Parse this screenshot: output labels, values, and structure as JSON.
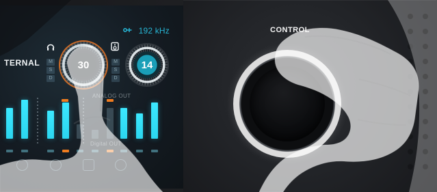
{
  "screen": {
    "freq_text": "192 kHz",
    "ternal_text": "TERNAL",
    "dial_left_value": "30",
    "dial_right_value": "14",
    "analog_out_label": "ANALOG OUT",
    "digital_out_label": "Digital OUT",
    "msd": [
      "M",
      "S",
      "D"
    ]
  },
  "panel": {
    "control_label": "CONTROL"
  },
  "colors": {
    "accent_cyan": "#27b7d6",
    "accent_orange": "#f07c1f",
    "control_text": "#f4f4f4"
  },
  "icons": {
    "headphones": "headphones-icon",
    "speaker": "speaker-icon",
    "network": "network-icon",
    "input_left": "input-icon",
    "input_mid": "input-icon",
    "input_right": "input-icon"
  }
}
